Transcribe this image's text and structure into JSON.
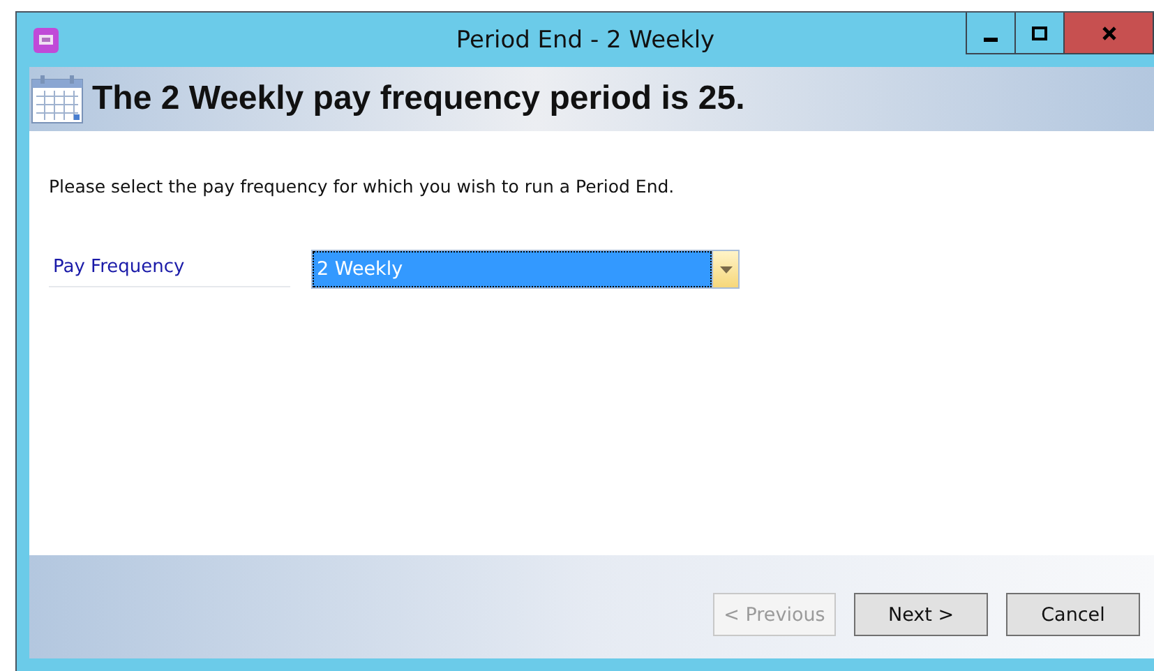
{
  "window": {
    "title": "Period End - 2 Weekly"
  },
  "header": {
    "title": "The 2 Weekly pay frequency period is 25."
  },
  "instruction": "Please select the pay frequency for which you wish to run a Period End.",
  "pay_frequency": {
    "label": "Pay Frequency",
    "value": "2 Weekly",
    "focused": true
  },
  "buttons": [
    {
      "label": "< Previous",
      "disabled": true
    },
    {
      "label": "Next >",
      "disabled": false
    },
    {
      "label": "Cancel",
      "disabled": false
    }
  ]
}
